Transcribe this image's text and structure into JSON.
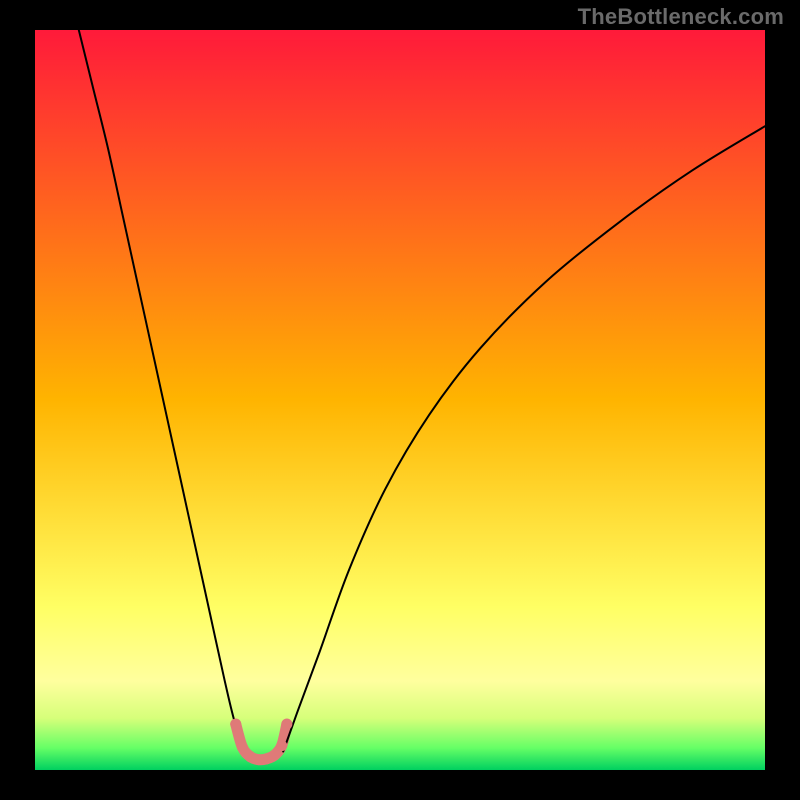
{
  "watermark": "TheBottleneck.com",
  "chart_data": {
    "type": "line",
    "title": "",
    "xlabel": "",
    "ylabel": "",
    "xlim": [
      0,
      100
    ],
    "ylim": [
      0,
      100
    ],
    "background_gradient": {
      "stops": [
        {
          "offset": 0.0,
          "color": "#ff1a3a"
        },
        {
          "offset": 0.5,
          "color": "#ffb400"
        },
        {
          "offset": 0.78,
          "color": "#ffff64"
        },
        {
          "offset": 0.88,
          "color": "#ffff9e"
        },
        {
          "offset": 0.93,
          "color": "#d6ff7a"
        },
        {
          "offset": 0.97,
          "color": "#66ff66"
        },
        {
          "offset": 1.0,
          "color": "#00d060"
        }
      ]
    },
    "series": [
      {
        "name": "left-curve",
        "x": [
          6,
          8,
          10,
          12,
          14,
          16,
          18,
          20,
          22,
          24,
          26,
          27.5,
          29
        ],
        "y": [
          100,
          92,
          84,
          75,
          66,
          57,
          48,
          39,
          30,
          21,
          12,
          6,
          2.5
        ],
        "stroke": "#000000",
        "stroke_width": 2
      },
      {
        "name": "right-curve",
        "x": [
          34,
          36,
          39,
          43,
          48,
          54,
          61,
          70,
          80,
          90,
          100
        ],
        "y": [
          2.5,
          8,
          16,
          27,
          38,
          48,
          57,
          66,
          74,
          81,
          87
        ],
        "stroke": "#000000",
        "stroke_width": 2
      },
      {
        "name": "bottom-marker-arc",
        "x": [
          27.5,
          28.4,
          29.5,
          30.6,
          31.7,
          32.8,
          33.8,
          34.5
        ],
        "y": [
          6.2,
          3.1,
          1.8,
          1.4,
          1.5,
          2.0,
          3.3,
          6.2
        ],
        "stroke": "#df7a78",
        "stroke_width": 11,
        "dotted": true
      }
    ]
  }
}
